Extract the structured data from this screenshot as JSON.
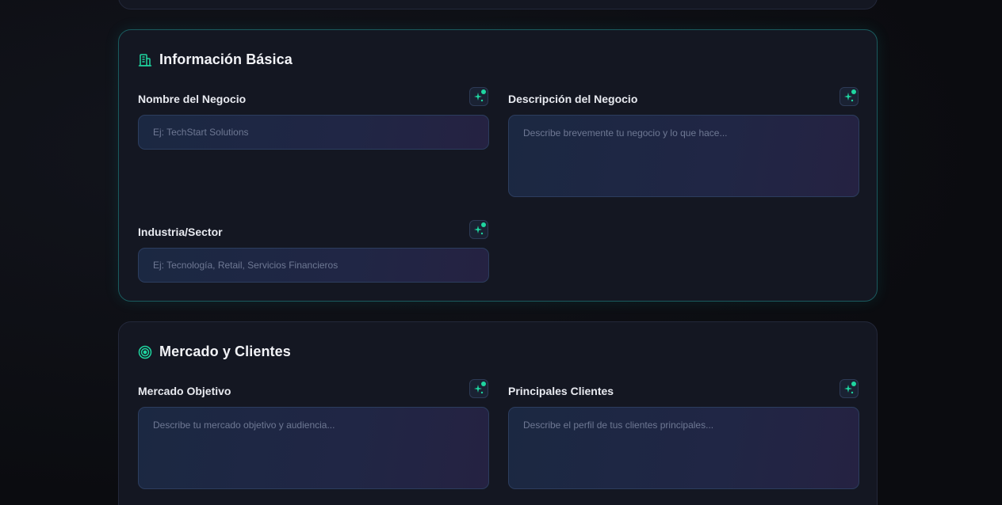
{
  "sections": {
    "basic": {
      "title": "Información Básica",
      "icon": "building-icon",
      "fields": {
        "business_name": {
          "label": "Nombre del Negocio",
          "placeholder": "Ej: TechStart Solutions",
          "value": ""
        },
        "business_description": {
          "label": "Descripción del Negocio",
          "placeholder": "Describe brevemente tu negocio y lo que hace...",
          "value": ""
        },
        "industry": {
          "label": "Industria/Sector",
          "placeholder": "Ej: Tecnología, Retail, Servicios Financieros",
          "value": ""
        }
      }
    },
    "market": {
      "title": "Mercado y Clientes",
      "icon": "target-icon",
      "fields": {
        "target_market": {
          "label": "Mercado Objetivo",
          "placeholder": "Describe tu mercado objetivo y audiencia...",
          "value": ""
        },
        "main_clients": {
          "label": "Principales Clientes",
          "placeholder": "Describe el perfil de tus clientes principales...",
          "value": ""
        }
      }
    }
  },
  "ai_button": {
    "icon": "sparkle-icon",
    "status_color": "#1fd6a0"
  },
  "colors": {
    "accent": "#1fd6a0",
    "active_border": "#1a5a5e",
    "card_bg": "#141722",
    "page_bg": "#0e0f14"
  }
}
